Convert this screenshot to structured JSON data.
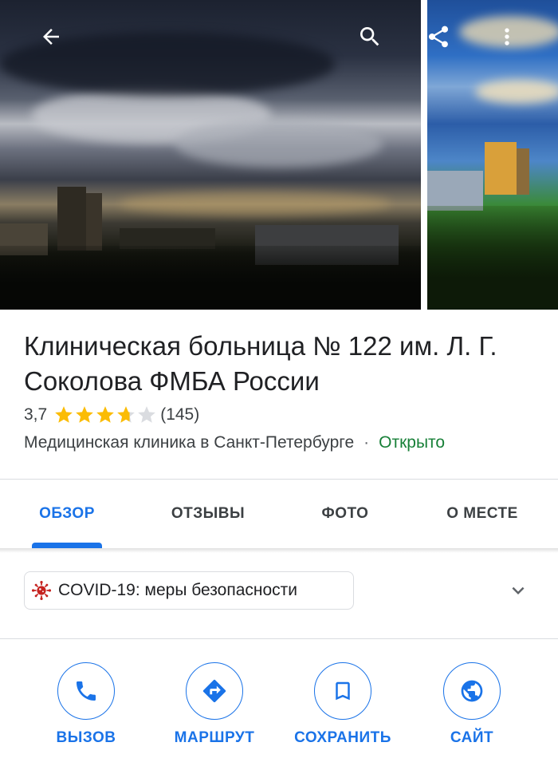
{
  "place": {
    "title": "Клиническая больница № 122 им. Л. Г. Соколова ФМБА России",
    "rating_value": "3,7",
    "rating_stars": 3.7,
    "reviews_count": "(145)",
    "category": "Медицинская клиника в Санкт-Петербурге",
    "separator": "·",
    "status": "Открыто"
  },
  "top_bar": {
    "icons": [
      "back-arrow-icon",
      "search-icon",
      "share-icon",
      "more-vert-icon"
    ]
  },
  "tabs": [
    {
      "label": "ОБЗОР",
      "active": true
    },
    {
      "label": "ОТЗЫВЫ",
      "active": false
    },
    {
      "label": "ФОТО",
      "active": false
    },
    {
      "label": "О МЕСТЕ",
      "active": false
    }
  ],
  "covid": {
    "label": "COVID-19: меры безопасности",
    "icon": "virus-icon"
  },
  "actions": [
    {
      "label": "ВЫЗОВ",
      "icon": "phone-icon"
    },
    {
      "label": "МАРШРУТ",
      "icon": "directions-icon"
    },
    {
      "label": "СОХРАНИТЬ",
      "icon": "bookmark-icon"
    },
    {
      "label": "САЙТ",
      "icon": "globe-icon"
    }
  ],
  "colors": {
    "accent": "#1a73e8",
    "open": "#188038",
    "star": "#fbbc04",
    "covid": "#c5221f"
  }
}
